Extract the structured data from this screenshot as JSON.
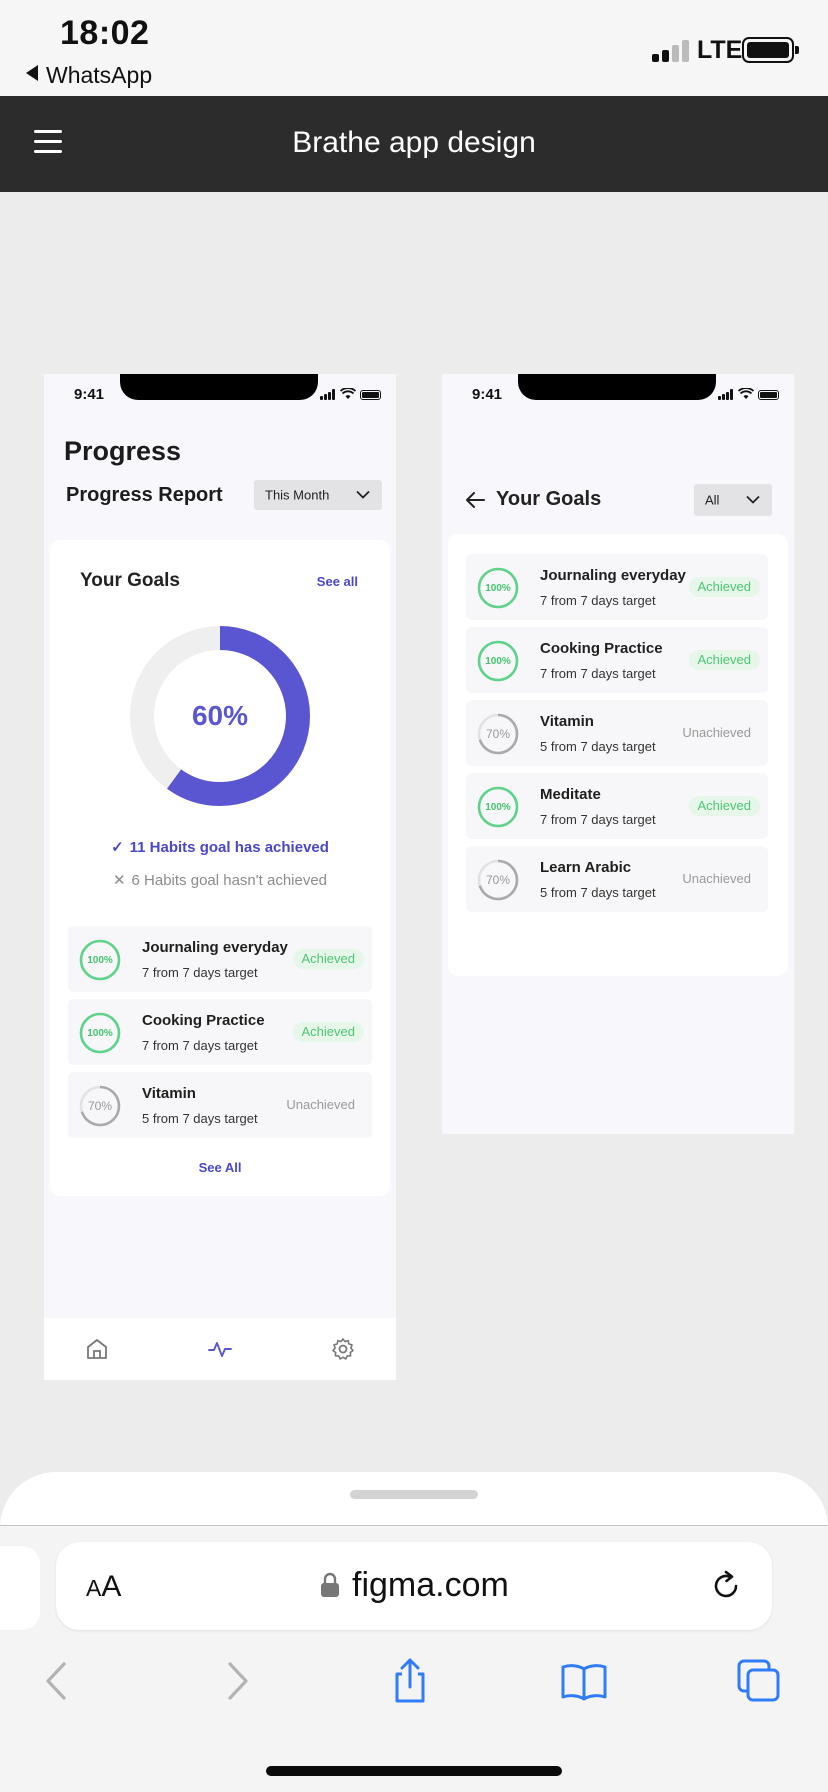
{
  "ios": {
    "time": "18:02",
    "back_app": "WhatsApp",
    "network": "LTE"
  },
  "figma": {
    "file_title": "Brathe app design",
    "menu_icon": "hamburger-menu-icon"
  },
  "progress_screen": {
    "status_time": "9:41",
    "title": "Progress",
    "report_label": "Progress Report",
    "period_dropdown": "This Month",
    "card": {
      "heading": "Your Goals",
      "see_all_top": "See all",
      "donut": {
        "percent_label": "60%",
        "fraction": 0.6
      },
      "achieved_text": "11 Habits goal has achieved",
      "not_achieved_text": "6 Habits goal hasn't achieved",
      "goals": [
        {
          "name": "Journaling everyday",
          "target": "7 from 7 days target",
          "ring_label": "100%",
          "fraction": 1.0,
          "status": "Achieved"
        },
        {
          "name": "Cooking Practice",
          "target": "7 from 7 days target",
          "ring_label": "100%",
          "fraction": 1.0,
          "status": "Achieved"
        },
        {
          "name": "Vitamin",
          "target": "5 from 7 days target",
          "ring_label": "70%",
          "fraction": 0.7,
          "status": "Unachieved"
        }
      ],
      "see_all_bottom": "See All"
    },
    "tabbar": [
      "home-icon",
      "activity-icon",
      "settings-icon"
    ],
    "colors": {
      "accent": "#5a56d2",
      "success": "#4cc672",
      "muted": "#9a9a9a"
    }
  },
  "goals_screen": {
    "status_time": "9:41",
    "title": "Your Goals",
    "filter_dropdown": "All",
    "goals": [
      {
        "name": "Journaling everyday",
        "target": "7 from 7 days target",
        "ring_label": "100%",
        "fraction": 1.0,
        "status": "Achieved"
      },
      {
        "name": "Cooking Practice",
        "target": "7 from 7 days target",
        "ring_label": "100%",
        "fraction": 1.0,
        "status": "Achieved"
      },
      {
        "name": "Vitamin",
        "target": "5 from 7 days target",
        "ring_label": "70%",
        "fraction": 0.7,
        "status": "Unachieved"
      },
      {
        "name": "Meditate",
        "target": "7 from 7 days target",
        "ring_label": "100%",
        "fraction": 1.0,
        "status": "Achieved"
      },
      {
        "name": "Learn Arabic",
        "target": "5 from 7 days target",
        "ring_label": "70%",
        "fraction": 0.7,
        "status": "Unachieved"
      }
    ]
  },
  "safari": {
    "aa_label": "AA",
    "url": "figma.com",
    "toolbar": [
      "back-icon",
      "forward-icon",
      "share-icon",
      "bookmarks-icon",
      "tabs-icon"
    ]
  }
}
